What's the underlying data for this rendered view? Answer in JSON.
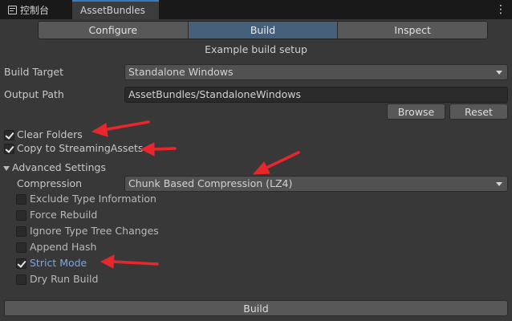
{
  "tabs": {
    "console_label": "控制台",
    "assetbundles_label": "AssetBundles",
    "menu_icon": "⋮"
  },
  "toolbar": {
    "items": [
      "Configure",
      "Build",
      "Inspect"
    ],
    "active": "Build"
  },
  "subtitle": "Example build setup",
  "build_target": {
    "label": "Build Target",
    "value": "Standalone Windows"
  },
  "output_path": {
    "label": "Output Path",
    "value": "AssetBundles/StandaloneWindows",
    "browse_label": "Browse",
    "reset_label": "Reset"
  },
  "options": {
    "clear_folders": {
      "label": "Clear Folders",
      "checked": true
    },
    "copy_streaming": {
      "label": "Copy to StreamingAssets",
      "checked": true
    }
  },
  "advanced": {
    "label": "Advanced Settings",
    "expanded": true,
    "compression": {
      "label": "Compression",
      "value": "Chunk Based Compression (LZ4)"
    },
    "items": [
      {
        "label": "Exclude Type Information",
        "checked": false
      },
      {
        "label": "Force Rebuild",
        "checked": false
      },
      {
        "label": "Ignore Type Tree Changes",
        "checked": false
      },
      {
        "label": "Append Hash",
        "checked": false
      },
      {
        "label": "Strict Mode",
        "checked": true
      },
      {
        "label": "Dry Run Build",
        "checked": false
      }
    ]
  },
  "build_button_label": "Build",
  "colors": {
    "background": "#383838",
    "active_segment": "#46607c",
    "annotation_arrow": "#e8262b",
    "highlight_label": "#7aa7e0"
  }
}
